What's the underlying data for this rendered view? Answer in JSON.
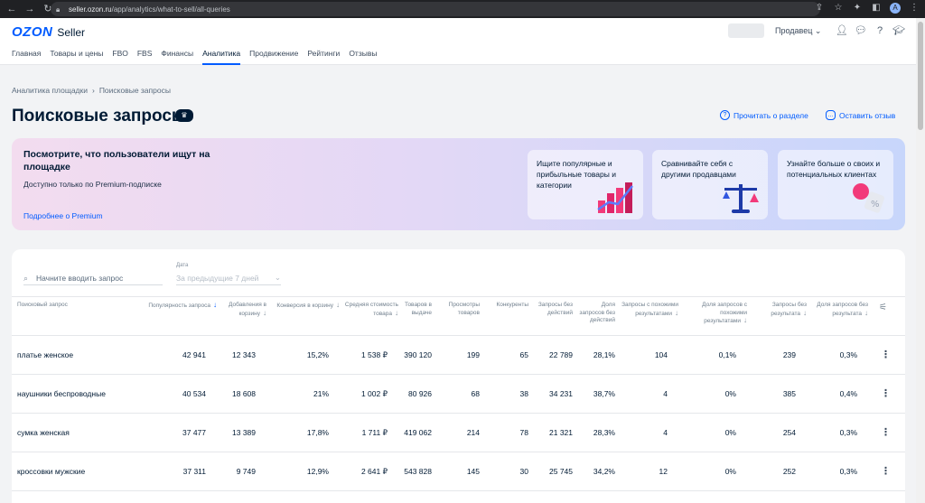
{
  "browser": {
    "url_host": "seller.ozon.ru",
    "url_path": "/app/analytics/what-to-sell/all-queries",
    "profile_initial": "A"
  },
  "header": {
    "logo_brand": "OZON",
    "logo_suffix": "Seller",
    "role_label": "Продавец",
    "nav": [
      "Главная",
      "Товары и цены",
      "FBO",
      "FBS",
      "Финансы",
      "Аналитика",
      "Продвижение",
      "Рейтинги",
      "Отзывы"
    ],
    "active_nav_index": 5
  },
  "breadcrumb": {
    "parent": "Аналитика площадки",
    "current": "Поисковые запросы"
  },
  "page": {
    "title": "Поисковые запросы",
    "read_link": "Прочитать о разделе",
    "feedback_link": "Оставить отзыв"
  },
  "banner": {
    "title": "Посмотрите, что пользователи ищут на площадке",
    "subtitle": "Доступно только по Premium-подписке",
    "link": "Подробнее о Premium",
    "cards": [
      "Ищите популярные и прибыльные товары и категории",
      "Сравнивайте себя с другими продавцами",
      "Узнайте больше о своих и потенциальных клиентах"
    ]
  },
  "filters": {
    "search_placeholder": "Начните вводить запрос",
    "date_label": "Дата",
    "date_value": "За предыдущие 7 дней"
  },
  "table": {
    "columns": [
      "Поисковый запрос",
      "Популярность запроса",
      "Добавления в корзину",
      "Конверсия в корзину",
      "Средняя стоимость товара",
      "Товаров в выдаче",
      "Просмотры товаров",
      "Конкуренты",
      "Запросы без действий",
      "Доля запросов без действий",
      "Запросы с похожими результатами",
      "Доля запросов с похожими результатами",
      "Запросы без результата",
      "Доля запросов без результата"
    ],
    "rows": [
      [
        "платье женское",
        "42 941",
        "12 343",
        "15,2%",
        "1 538 ₽",
        "390 120",
        "199",
        "65",
        "22 789",
        "28,1%",
        "104",
        "0,1%",
        "239",
        "0,3%"
      ],
      [
        "наушники беспроводные",
        "40 534",
        "18 608",
        "21%",
        "1 002 ₽",
        "80 926",
        "68",
        "38",
        "34 231",
        "38,7%",
        "4",
        "0%",
        "385",
        "0,4%"
      ],
      [
        "сумка женская",
        "37 477",
        "13 389",
        "17,8%",
        "1 711 ₽",
        "419 062",
        "214",
        "78",
        "21 321",
        "28,3%",
        "4",
        "0%",
        "254",
        "0,3%"
      ],
      [
        "кроссовки мужские",
        "37 311",
        "9 749",
        "12,9%",
        "2 641 ₽",
        "543 828",
        "145",
        "30",
        "25 745",
        "34,2%",
        "12",
        "0%",
        "252",
        "0,3%"
      ]
    ]
  }
}
